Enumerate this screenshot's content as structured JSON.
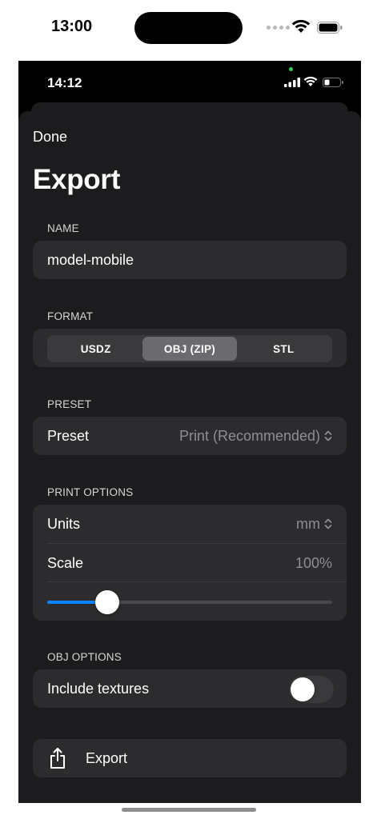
{
  "outer_status": {
    "time": "13:00"
  },
  "status": {
    "time": "14:12"
  },
  "nav": {
    "done_label": "Done",
    "title": "Export"
  },
  "name_section": {
    "label": "NAME",
    "value": "model-mobile"
  },
  "format_section": {
    "label": "FORMAT",
    "options": [
      "USDZ",
      "OBJ (ZIP)",
      "STL"
    ],
    "selected": "OBJ (ZIP)"
  },
  "preset_section": {
    "label": "PRESET",
    "row_label": "Preset",
    "value": "Print (Recommended)"
  },
  "print_options": {
    "label": "PRINT OPTIONS",
    "units_label": "Units",
    "units_value": "mm",
    "scale_label": "Scale",
    "scale_value": "100%",
    "slider_fraction": 0.21
  },
  "obj_options": {
    "label": "OBJ OPTIONS",
    "textures_label": "Include textures",
    "textures_on": false
  },
  "export_button": {
    "label": "Export",
    "icon": "share-icon"
  },
  "colors": {
    "accent": "#0a84ff",
    "sheet": "#1c1c1e",
    "card": "#2c2c2e",
    "secondary_text": "#8e8e93"
  }
}
